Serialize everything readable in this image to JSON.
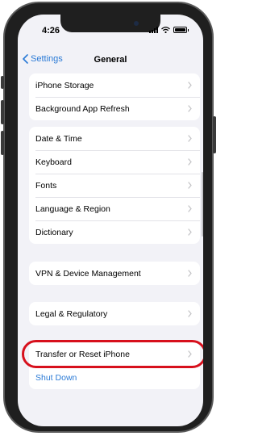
{
  "status_bar": {
    "time": "4:26"
  },
  "navbar": {
    "back_label": "Settings",
    "title": "General"
  },
  "groups": [
    {
      "rows": [
        {
          "label": "iPhone Storage"
        },
        {
          "label": "Background App Refresh"
        }
      ]
    },
    {
      "rows": [
        {
          "label": "Date & Time"
        },
        {
          "label": "Keyboard"
        },
        {
          "label": "Fonts"
        },
        {
          "label": "Language & Region"
        },
        {
          "label": "Dictionary"
        }
      ]
    },
    {
      "rows": [
        {
          "label": "VPN & Device Management"
        }
      ]
    },
    {
      "rows": [
        {
          "label": "Legal & Regulatory"
        }
      ]
    },
    {
      "rows": [
        {
          "label": "Transfer or Reset iPhone"
        },
        {
          "label": "Shut Down"
        }
      ]
    }
  ],
  "colors": {
    "accent": "#2a7ad6",
    "highlight": "#d7101c",
    "background": "#f2f2f7"
  },
  "icons": {
    "back": "chevron-left-icon",
    "row_disclosure": "chevron-right-icon"
  }
}
